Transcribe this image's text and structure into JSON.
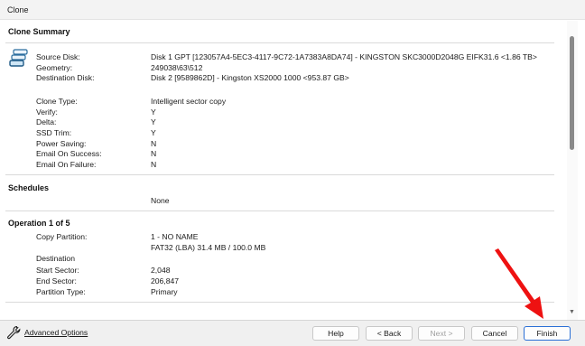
{
  "window": {
    "title": "Clone"
  },
  "clone_summary": {
    "heading": "Clone Summary",
    "disk_rows": [
      {
        "label": "Source Disk:",
        "value": "Disk 1 GPT [123057A4-5EC3-4117-9C72-1A7383A8DA74] - KINGSTON SKC3000D2048G EIFK31.6  <1.86 TB>"
      },
      {
        "label": "Geometry:",
        "value": "249038\\63\\512"
      },
      {
        "label": "Destination Disk:",
        "value": "Disk 2 [9589862D] - Kingston XS2000 1000  <953.87 GB>"
      }
    ],
    "option_rows": [
      {
        "label": "Clone Type:",
        "value": "Intelligent sector copy"
      },
      {
        "label": "Verify:",
        "value": "Y"
      },
      {
        "label": "Delta:",
        "value": "Y"
      },
      {
        "label": "SSD Trim:",
        "value": "Y"
      },
      {
        "label": "Power Saving:",
        "value": "N"
      },
      {
        "label": "Email On Success:",
        "value": "N"
      },
      {
        "label": "Email On Failure:",
        "value": "N"
      }
    ]
  },
  "schedules": {
    "heading": "Schedules",
    "value": "None"
  },
  "operation": {
    "heading": "Operation 1 of 5",
    "copy_partition_label": "Copy Partition:",
    "copy_partition_value": "1 - NO NAME",
    "copy_partition_detail": "FAT32 (LBA) 31.4 MB / 100.0 MB",
    "destination_label": "Destination",
    "rows": [
      {
        "label": "Start Sector:",
        "value": "2,048"
      },
      {
        "label": "End Sector:",
        "value": "206,847"
      },
      {
        "label": "Partition Type:",
        "value": "Primary"
      }
    ]
  },
  "footer": {
    "advanced_options": "Advanced Options",
    "help": "Help",
    "back": "< Back",
    "next": "Next >",
    "cancel": "Cancel",
    "finish": "Finish"
  },
  "icons": {
    "disk": "disk-stack-icon",
    "wrench": "wrench-icon",
    "annotation": "red-arrow"
  },
  "colors": {
    "annotation_arrow": "#ee1111",
    "finish_border": "#2a6fd6"
  }
}
